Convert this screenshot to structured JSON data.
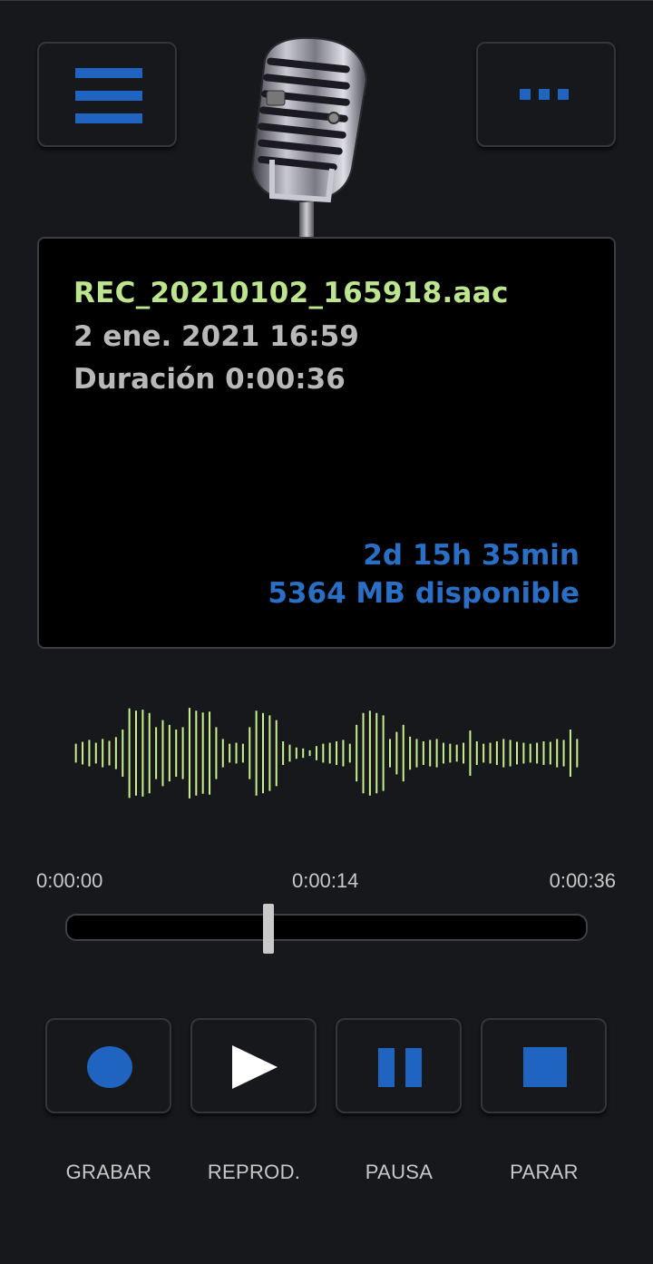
{
  "header": {
    "menu_icon": "hamburger-menu-icon",
    "more_icon": "more-dots-icon",
    "logo_icon": "microphone-logo-icon",
    "accent_color": "#1e64c0"
  },
  "recording": {
    "filename": "REC_20210102_165918.aac",
    "datetime": "2 ene. 2021 16:59",
    "duration": "Duración 0:00:36",
    "remaining_time": "2d 15h 35min",
    "storage_available": "5364 MB disponible",
    "filename_color": "#bde58e",
    "storage_color": "#2a6fc6"
  },
  "waveform": {
    "color": "#c8f08c",
    "amplitudes": [
      0.2,
      0.24,
      0.28,
      0.22,
      0.3,
      0.26,
      0.34,
      0.5,
      0.95,
      0.9,
      0.92,
      0.85,
      0.55,
      0.7,
      0.6,
      0.5,
      0.55,
      0.96,
      0.9,
      0.86,
      0.88,
      0.55,
      0.3,
      0.2,
      0.22,
      0.2,
      0.55,
      0.9,
      0.85,
      0.8,
      0.7,
      0.25,
      0.18,
      0.12,
      0.1,
      0.06,
      0.15,
      0.2,
      0.22,
      0.25,
      0.28,
      0.2,
      0.6,
      0.85,
      0.9,
      0.85,
      0.8,
      0.3,
      0.45,
      0.6,
      0.35,
      0.3,
      0.25,
      0.28,
      0.3,
      0.22,
      0.2,
      0.18,
      0.22,
      0.48,
      0.25,
      0.2,
      0.22,
      0.25,
      0.3,
      0.28,
      0.24,
      0.22,
      0.2,
      0.22,
      0.25,
      0.24,
      0.3,
      0.28,
      0.5,
      0.3
    ]
  },
  "playback": {
    "time_start": "0:00:00",
    "time_current": "0:00:14",
    "time_end": "0:00:36",
    "progress": 0.3889
  },
  "controls": {
    "record_label": "GRABAR",
    "play_label": "REPROD.",
    "pause_label": "PAUSA",
    "stop_label": "PARAR",
    "record_icon": "record-dot-icon",
    "play_icon": "play-icon",
    "pause_icon": "pause-icon",
    "stop_icon": "stop-icon"
  }
}
